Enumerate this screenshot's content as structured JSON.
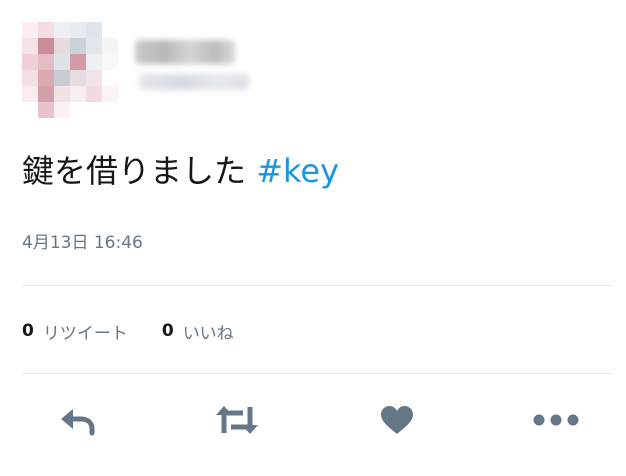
{
  "tweet": {
    "text_main": "鍵を借りました",
    "hashtag": "#key",
    "timestamp": "4月13日 16:46"
  },
  "stats": {
    "retweet_count": "0",
    "retweet_label": "リツイート",
    "like_count": "0",
    "like_label": "いいね"
  },
  "actions": {
    "reply_icon": "reply-icon",
    "retweet_icon": "retweet-icon",
    "like_icon": "heart-icon",
    "more_icon": "more-icon"
  },
  "colors": {
    "text": "#14171a",
    "muted": "#657786",
    "link": "#1b95e0",
    "icon": "#657786",
    "divider": "#e1e8ed"
  }
}
